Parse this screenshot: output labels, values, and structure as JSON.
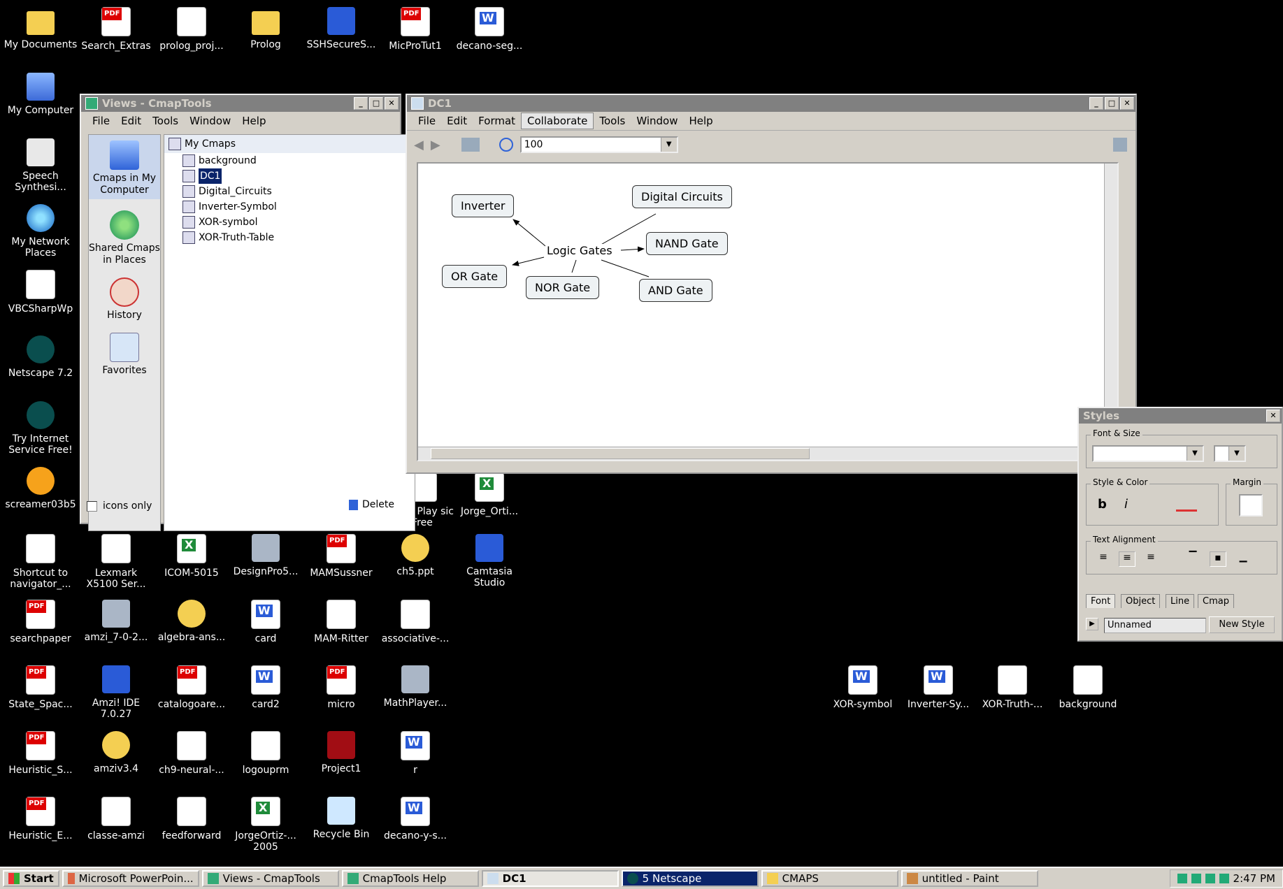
{
  "desktop_icons": [
    {
      "label": "My Documents",
      "type": "folder"
    },
    {
      "label": "Search_Extras",
      "type": "pdf"
    },
    {
      "label": "prolog_proj...",
      "type": "doc"
    },
    {
      "label": "Prolog",
      "type": "folder"
    },
    {
      "label": "SSHSecureS...",
      "type": "blue"
    },
    {
      "label": "MicProTut1",
      "type": "pdf"
    },
    {
      "label": "decano-seg...",
      "type": "word"
    },
    {
      "label": "My Computer",
      "type": "computer"
    },
    {
      "label": "Speech Synthesi...",
      "type": "speech"
    },
    {
      "label": "My Network Places",
      "type": "net"
    },
    {
      "label": "VBCSharpWp",
      "type": "doc"
    },
    {
      "label": "Netscape 7.2",
      "type": "netscape"
    },
    {
      "label": "Try Internet Service Free!",
      "type": "netscape"
    },
    {
      "label": "screamer03b5",
      "type": "orange"
    },
    {
      "label": "Shortcut to navigator_...",
      "type": "doc"
    },
    {
      "label": "Lexmark X5100 Ser...",
      "type": "doc"
    },
    {
      "label": "ICOM-5015",
      "type": "excel"
    },
    {
      "label": "DesignPro5...",
      "type": "gray"
    },
    {
      "label": "MAMSussner",
      "type": "pdf"
    },
    {
      "label": "ch5.ppt",
      "type": "zip"
    },
    {
      "label": "Camtasia Studio",
      "type": "blue"
    },
    {
      "label": "searchpaper",
      "type": "pdf"
    },
    {
      "label": "amzi_7-0-2...",
      "type": "gray"
    },
    {
      "label": "algebra-ans...",
      "type": "zip"
    },
    {
      "label": "card",
      "type": "word"
    },
    {
      "label": "MAM-Ritter",
      "type": "doc"
    },
    {
      "label": "associative-...",
      "type": "doc"
    },
    {
      "label": "State_Spac...",
      "type": "pdf"
    },
    {
      "label": "Amzi! IDE 7.0.27",
      "type": "blue"
    },
    {
      "label": "catalogoare...",
      "type": "pdf"
    },
    {
      "label": "card2",
      "type": "word"
    },
    {
      "label": "micro",
      "type": "pdf"
    },
    {
      "label": "MathPlayer...",
      "type": "gray"
    },
    {
      "label": "Heuristic_S...",
      "type": "pdf"
    },
    {
      "label": "amziv3.4",
      "type": "zip"
    },
    {
      "label": "ch9-neural-...",
      "type": "doc"
    },
    {
      "label": "logouprm",
      "type": "doc"
    },
    {
      "label": "Project1",
      "type": "red"
    },
    {
      "label": "r",
      "type": "word"
    },
    {
      "label": "Heuristic_E...",
      "type": "pdf"
    },
    {
      "label": "classe-amzi",
      "type": "doc"
    },
    {
      "label": "feedforward",
      "type": "doc"
    },
    {
      "label": "JorgeOrtiz-... 2005",
      "type": "excel"
    },
    {
      "label": "Recycle Bin",
      "type": "recycle"
    },
    {
      "label": "decano-y-s...",
      "type": "word"
    },
    {
      "label": "sody Play sic Free",
      "type": "doc"
    },
    {
      "label": "Jorge_Orti...",
      "type": "excel"
    },
    {
      "label": "XOR-symbol",
      "type": "word"
    },
    {
      "label": "Inverter-Sy...",
      "type": "word"
    },
    {
      "label": "XOR-Truth-...",
      "type": "doc"
    },
    {
      "label": "background",
      "type": "doc"
    }
  ],
  "views_window": {
    "title": "Views - CmapTools",
    "menu": [
      "File",
      "Edit",
      "Tools",
      "Window",
      "Help"
    ],
    "side": [
      {
        "label": "Cmaps in My Computer",
        "icon": "computer-icon"
      },
      {
        "label": "Shared Cmaps in Places",
        "icon": "globe-icon"
      },
      {
        "label": "History",
        "icon": "history-icon"
      },
      {
        "label": "Favorites",
        "icon": "favorites-icon"
      }
    ],
    "tree_root": "My Cmaps",
    "tree": [
      "background",
      "DC1",
      "Digital_Circuits",
      "Inverter-Symbol",
      "XOR-symbol",
      "XOR-Truth-Table"
    ],
    "selected": "DC1",
    "icons_only_label": "icons only",
    "delete_label": "Delete"
  },
  "dc1_window": {
    "title": "DC1",
    "menu": [
      "File",
      "Edit",
      "Format",
      "Collaborate",
      "Tools",
      "Window",
      "Help"
    ],
    "active_menu": "Collaborate",
    "zoom": "100",
    "nodes": {
      "inverter": "Inverter",
      "digital": "Digital Circuits",
      "logic": "Logic Gates",
      "nand": "NAND Gate",
      "or": "OR Gate",
      "nor": "NOR Gate",
      "and": "AND Gate"
    }
  },
  "styles_panel": {
    "title": "Styles",
    "font_size_label": "Font & Size",
    "style_color_label": "Style & Color",
    "margin_label": "Margin",
    "text_alignment_label": "Text Alignment",
    "bold": "b",
    "italic": "i",
    "tabs": [
      "Font",
      "Object",
      "Line",
      "Cmap"
    ],
    "style_name": "Unnamed",
    "new_style": "New Style"
  },
  "taskbar": {
    "start": "Start",
    "items": [
      "Microsoft PowerPoin...",
      "Views - CmapTools",
      "CmapTools Help",
      "DC1",
      "5 Netscape",
      "CMAPS",
      "untitled - Paint"
    ],
    "clock": "2:47 PM"
  }
}
